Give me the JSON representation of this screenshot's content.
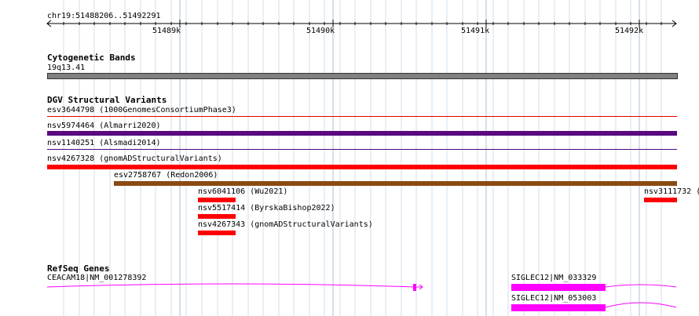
{
  "ruler": {
    "location": "chr19:51488206..51492291",
    "ticks": [
      "51489k",
      "51490k",
      "51491k",
      "51492k"
    ]
  },
  "cytogenetic": {
    "title": "Cytogenetic Bands",
    "band": "19q13.41"
  },
  "dgv": {
    "title": "DGV Structural Variants",
    "items": [
      {
        "label": "esv3644798 (1000GenomesConsortiumPhase3)",
        "color": "#e00000"
      },
      {
        "label": "nsv5974464 (Almarri2020)",
        "color": "#5a0a80"
      },
      {
        "label": "nsv1140251 (Alsmadi2014)",
        "color": "#4a0a80"
      },
      {
        "label": "nsv4267328 (gnomADStructuralVariants)",
        "color": "#ff0000"
      },
      {
        "label": "esv2758767 (Redon2006)",
        "color": "#8b4a14"
      },
      {
        "label": "nsv6041106 (Wu2021)",
        "color": "#ff0000"
      },
      {
        "label": "nsv5517414 (ByrskaBishop2022)",
        "color": "#ff0000"
      },
      {
        "label": "nsv4267343 (gnomADStructuralVariants)",
        "color": "#ff0000"
      },
      {
        "label": "nsv3111732 (",
        "color": "#ff0000"
      }
    ]
  },
  "refseq": {
    "title": "RefSeq Genes",
    "genes": [
      {
        "label": "CEACAM18|NM_001278392",
        "color": "#ff00ff"
      },
      {
        "label": "SIGLEC12|NM_033329",
        "color": "#ff00ff"
      },
      {
        "label": "SIGLEC12|NM_053003",
        "color": "#ff00ff"
      }
    ]
  },
  "colors": {
    "grid": "#d8e4f0",
    "band": "#808080"
  }
}
